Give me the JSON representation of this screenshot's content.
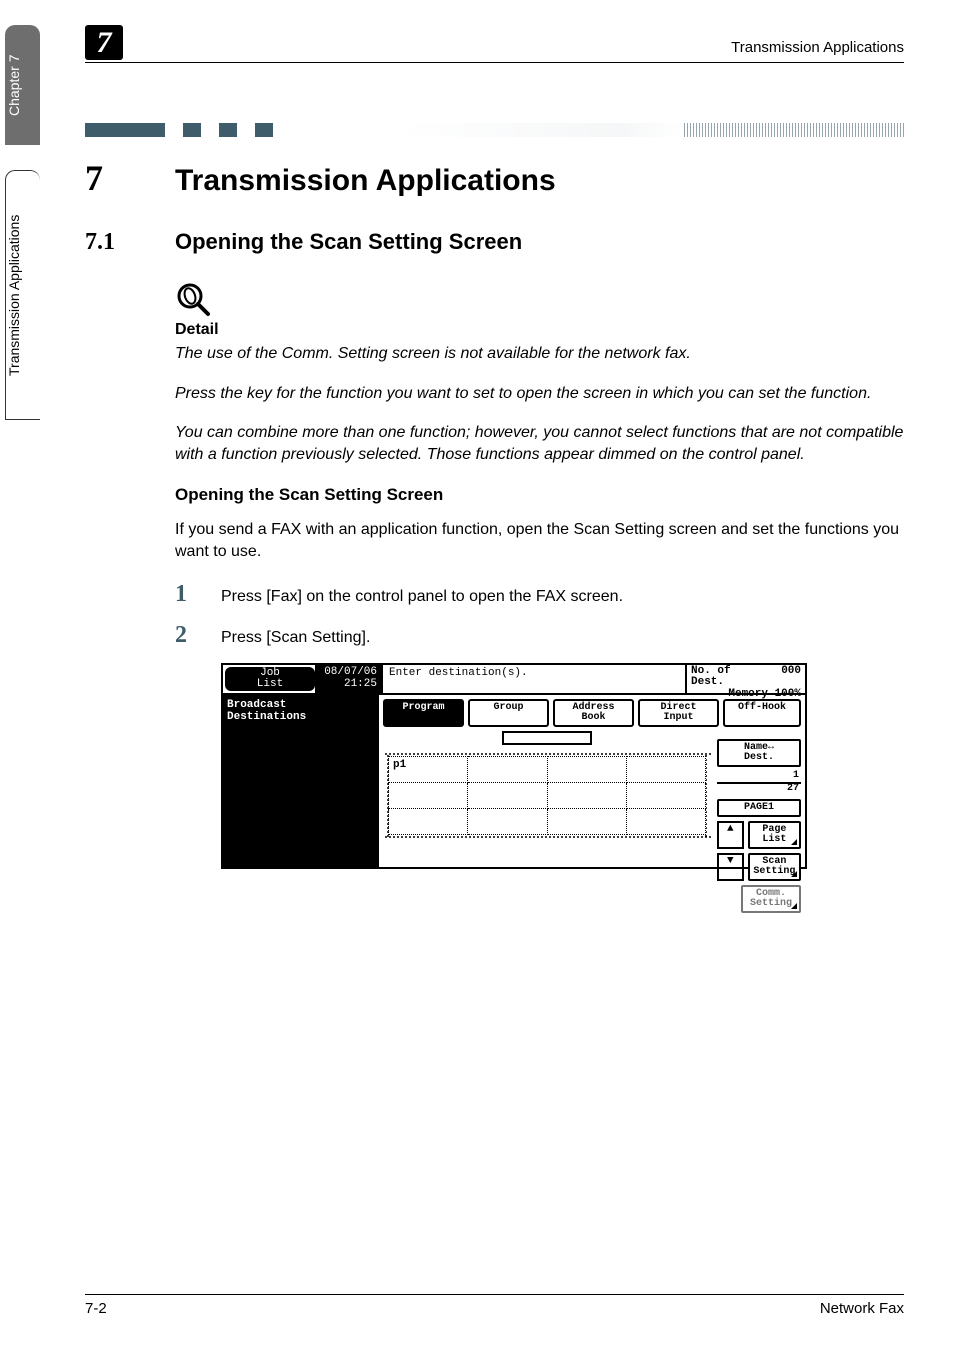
{
  "sideTabs": {
    "chapter": "Chapter 7",
    "section": "Transmission Applications"
  },
  "runningHeader": {
    "num": "7",
    "title": "Transmission Applications"
  },
  "h1": {
    "num": "7",
    "text": "Transmission Applications"
  },
  "h2": {
    "num": "7.1",
    "text": "Opening the Scan Setting Screen"
  },
  "detail": {
    "label": "Detail",
    "p1": "The use of the Comm. Setting screen is not available for the network fax.",
    "p2": "Press the key for the function you want to set to open the screen in which you can set the function.",
    "p3": "You can combine more than one function; however, you cannot select functions that are not compatible with a function previously selected. Those functions appear dimmed on the control panel."
  },
  "h3": "Opening the Scan Setting Screen",
  "intro": "If you send a FAX with an application function, open the Scan Setting screen and set the functions you want to use.",
  "steps": {
    "s1": {
      "num": "1",
      "text": "Press [Fax] on the control panel to open the FAX screen."
    },
    "s2": {
      "num": "2",
      "text": "Press [Scan Setting]."
    }
  },
  "fax": {
    "jobList": "Job\nList",
    "date": "08/07/06",
    "time": "21:25",
    "enterDest": "Enter destination(s).",
    "noOfDestLabel": "No. of\nDest.",
    "noOfDestVal": "000",
    "memory": "Memory 100%",
    "leftPanel": "Broadcast\nDestinations",
    "tabs": {
      "program": "Program",
      "group": "Group",
      "address": "Address\nBook",
      "direct": "Direct\nInput",
      "offhook": "Off-Hook"
    },
    "gridP1": "p1",
    "side": {
      "nameDest": "Name↔\nDest.",
      "pageInd1": "1",
      "pageInd2": "27",
      "page1": "PAGE1",
      "pageList": "Page\nList",
      "scanSetting": "Scan\nSetting",
      "commSetting": "Comm.\nSetting",
      "arrowUp": "▲",
      "arrowDown": "▼"
    }
  },
  "footer": {
    "left": "7-2",
    "right": "Network Fax"
  }
}
